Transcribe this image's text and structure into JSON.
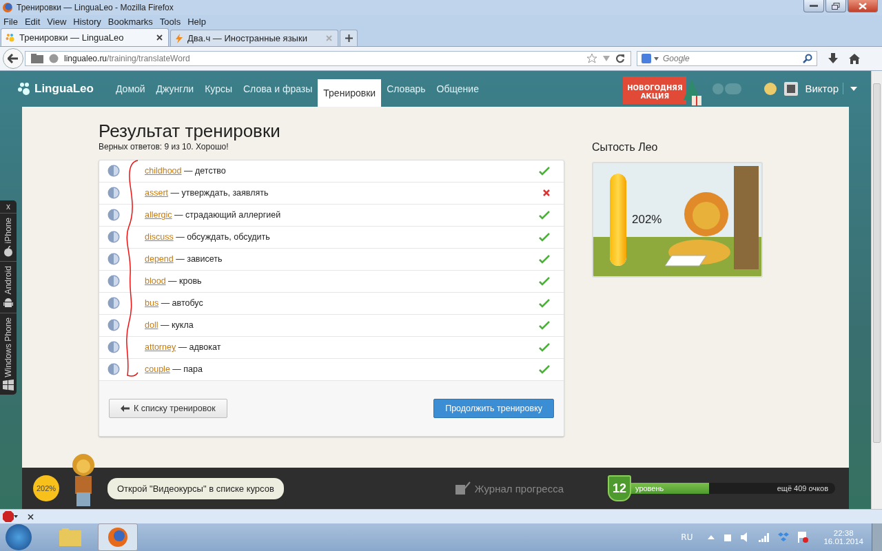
{
  "window": {
    "title": "Тренировки — LinguaLeo - Mozilla Firefox"
  },
  "menu": [
    "File",
    "Edit",
    "View",
    "History",
    "Bookmarks",
    "Tools",
    "Help"
  ],
  "tabs": [
    {
      "label": "Тренировки — LinguaLeo",
      "selected": true
    },
    {
      "label": "Два.ч — Иностранные языки",
      "selected": false
    }
  ],
  "address": {
    "host": "lingualeo.ru",
    "path": "/training/translateWord"
  },
  "search": {
    "placeholder": "Google"
  },
  "site": {
    "logo": "LinguaLeo",
    "nav": [
      {
        "label": "Домой",
        "selected": false
      },
      {
        "label": "Джунгли",
        "selected": false
      },
      {
        "label": "Курсы",
        "selected": false
      },
      {
        "label": "Слова и фразы",
        "selected": false
      },
      {
        "label": "Тренировки",
        "selected": true
      },
      {
        "label": "Словарь",
        "selected": false
      },
      {
        "label": "Общение",
        "selected": false
      }
    ],
    "promo": "НОВОГОДНЯЯ АКЦИЯ",
    "user": "Виктор"
  },
  "side_tabs": {
    "close": "x",
    "items": [
      {
        "label": "iPhone",
        "kind": "apple"
      },
      {
        "label": "Android",
        "kind": "android"
      },
      {
        "label": "Windows Phone",
        "kind": "windows"
      }
    ]
  },
  "result": {
    "title": "Результат тренировки",
    "summary": "Верных ответов: 9 из 10. Хорошо!",
    "rows": [
      {
        "word": "childhood",
        "translation": " — детство",
        "correct": true
      },
      {
        "word": "assert",
        "translation": " — утверждать, заявлять",
        "correct": false
      },
      {
        "word": "allergic",
        "translation": " — страдающий аллергией",
        "correct": true
      },
      {
        "word": "discuss",
        "translation": " — обсуждать, обсудить",
        "correct": true
      },
      {
        "word": "depend",
        "translation": " — зависеть",
        "correct": true
      },
      {
        "word": "blood",
        "translation": " — кровь",
        "correct": true
      },
      {
        "word": "bus",
        "translation": " — автобус",
        "correct": true
      },
      {
        "word": "doll",
        "translation": " — кукла",
        "correct": true
      },
      {
        "word": "attorney",
        "translation": " — адвокат",
        "correct": true
      },
      {
        "word": "couple",
        "translation": " — пара",
        "correct": true
      }
    ],
    "back_button": "К списку тренировок",
    "continue_button": "Продолжить тренировку"
  },
  "satiety": {
    "title": "Сытость Лео",
    "reading": "202%",
    "level": 1
  },
  "footer": {
    "badge": "202%",
    "tip": "Открой \"Видеокурсы\" в списке курсов",
    "journal": "Журнал прогресса",
    "level_number": "12",
    "level_label": "уровень",
    "remaining": "ещё 409 очков",
    "level": 0.39
  },
  "taskbar": {
    "lang": "RU",
    "time": "22:38",
    "date": "16.01.2014"
  }
}
